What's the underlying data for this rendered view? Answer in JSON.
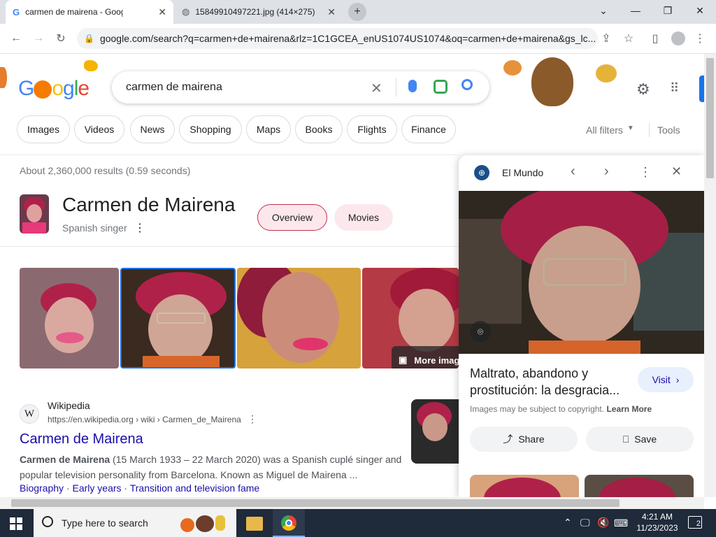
{
  "browser": {
    "tabs": [
      {
        "title": "carmen de mairena - Google Se",
        "active": true
      },
      {
        "title": "15849910497221.jpg (414×275)",
        "active": false
      }
    ],
    "url": "google.com/search?q=carmen+de+mairena&rlz=1C1GCEA_enUS1074US1074&oq=carmen+de+mairena&gs_lc..."
  },
  "search": {
    "logo": "Google",
    "query": "carmen de mairena",
    "chips": [
      "Images",
      "Videos",
      "News",
      "Shopping",
      "Maps",
      "Books",
      "Flights",
      "Finance"
    ],
    "all_filters": "All filters",
    "tools": "Tools",
    "results_count": "About 2,360,000 results (0.59 seconds)"
  },
  "knowledge_panel": {
    "title": "Carmen de Mairena",
    "subtitle": "Spanish singer",
    "tabs": [
      "Overview",
      "Movies"
    ],
    "more_images": "More images"
  },
  "result": {
    "site": "Wikipedia",
    "favicon": "W",
    "url": "https://en.wikipedia.org › wiki › Carmen_de_Mairena",
    "title": "Carmen de Mairena",
    "snippet_bold": "Carmen de Mairena",
    "snippet": " (15 March 1933 – 22 March 2020) was a Spanish cuplé singer and popular television personality from Barcelona. Known as Miguel de Mairena ...",
    "links": [
      "Biography",
      "Early years",
      "Transition and television fame"
    ]
  },
  "side_panel": {
    "source": "El Mundo",
    "caption": "Maltrato, abandono y prostitución: la desgracia...",
    "visit": "Visit",
    "copyright": "Images may be subject to copyright.",
    "learn_more": "Learn More",
    "share": "Share",
    "save": "Save"
  },
  "taskbar": {
    "search_placeholder": "Type here to search",
    "time": "4:21 AM",
    "date": "11/23/2023",
    "notifications": "2"
  },
  "colors": {
    "link": "#1a0dab",
    "pill_pink": "#fce8ec",
    "hair": "#b0214a"
  }
}
